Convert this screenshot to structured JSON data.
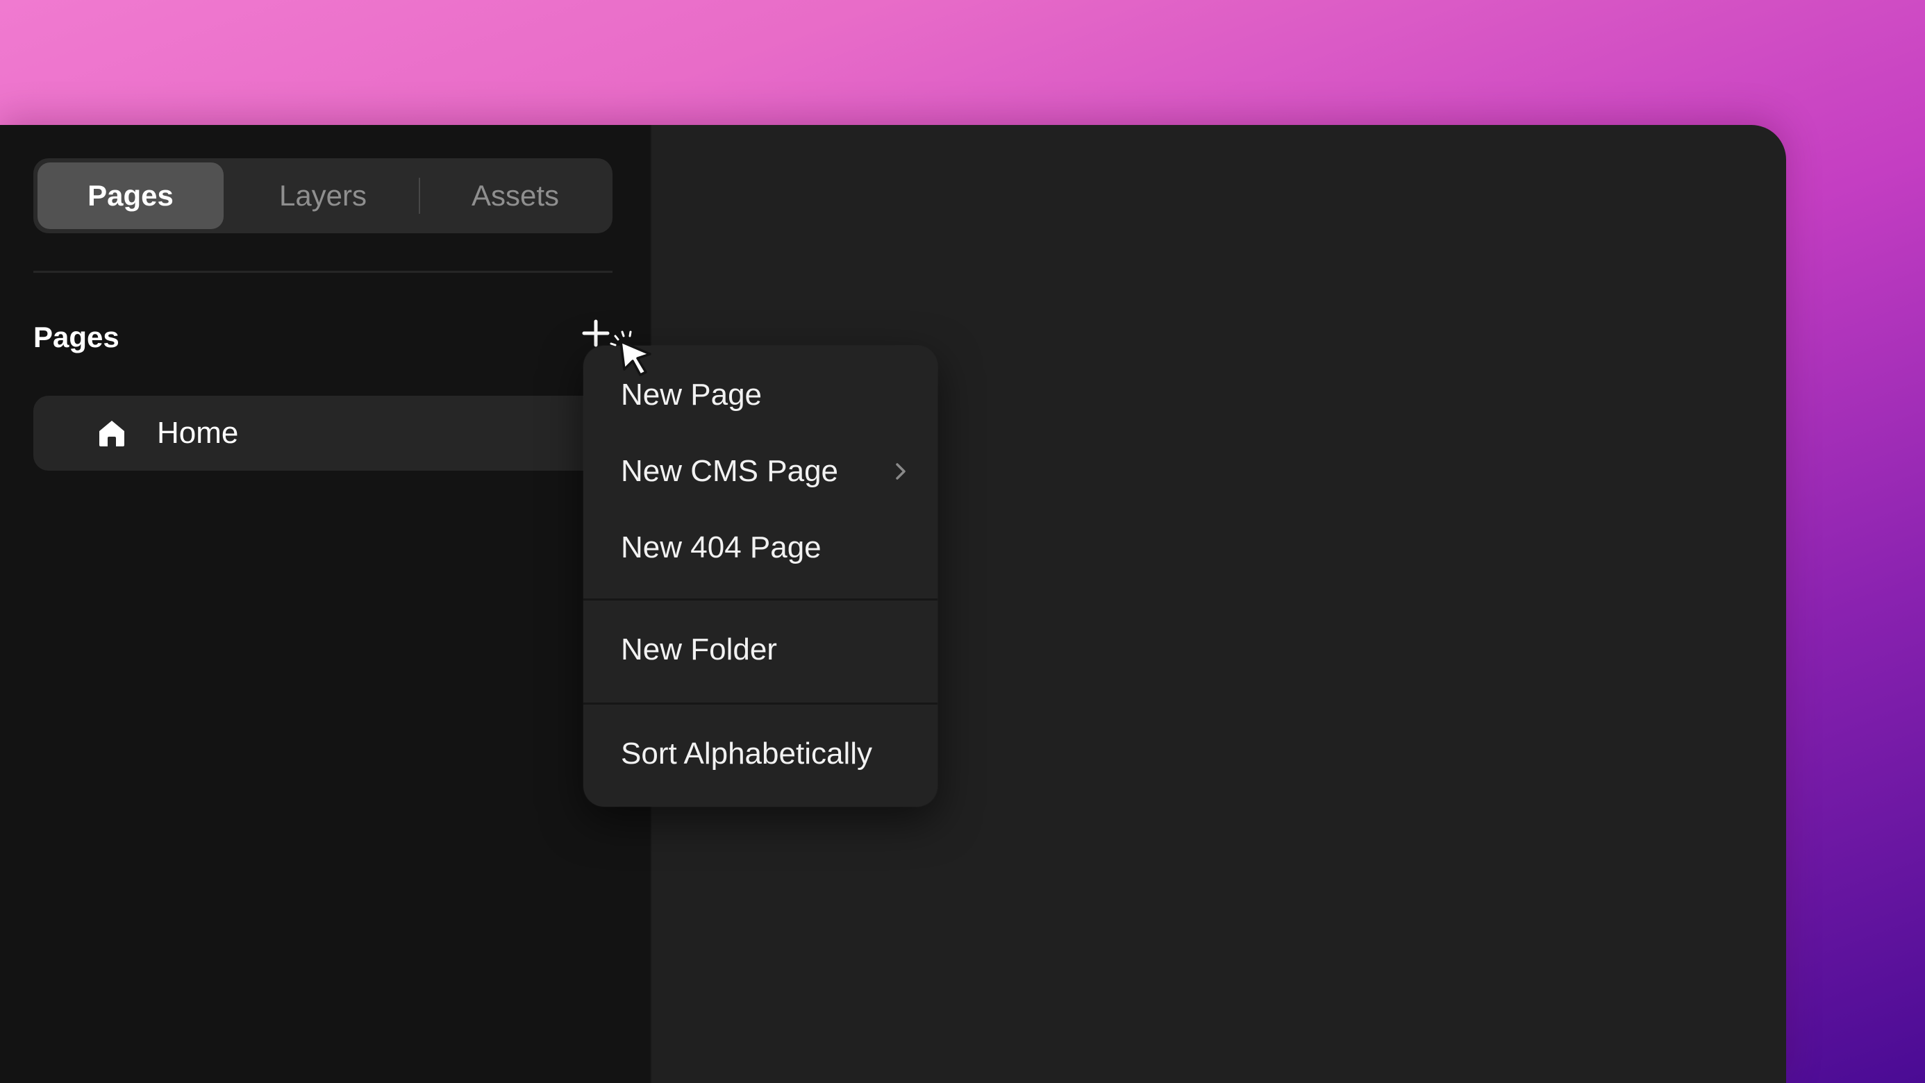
{
  "sidebar": {
    "tabs": [
      {
        "label": "Pages",
        "active": true
      },
      {
        "label": "Layers",
        "active": false
      },
      {
        "label": "Assets",
        "active": false
      }
    ],
    "section_title": "Pages",
    "pages": [
      {
        "label": "Home",
        "icon": "home-icon"
      }
    ]
  },
  "context_menu": {
    "items": [
      {
        "label": "New Page"
      },
      {
        "label": "New CMS Page",
        "has_submenu": true
      },
      {
        "label": "New 404 Page"
      },
      {
        "label": "New Folder"
      },
      {
        "label": "Sort Alphabetically"
      }
    ]
  },
  "colors": {
    "window_bg": "#202020",
    "sidebar_bg": "#131313",
    "active_tab_bg": "#525252",
    "menu_bg": "#232323",
    "backdrop_top": "#f07ad0",
    "backdrop_bottom": "#4a0b94"
  }
}
